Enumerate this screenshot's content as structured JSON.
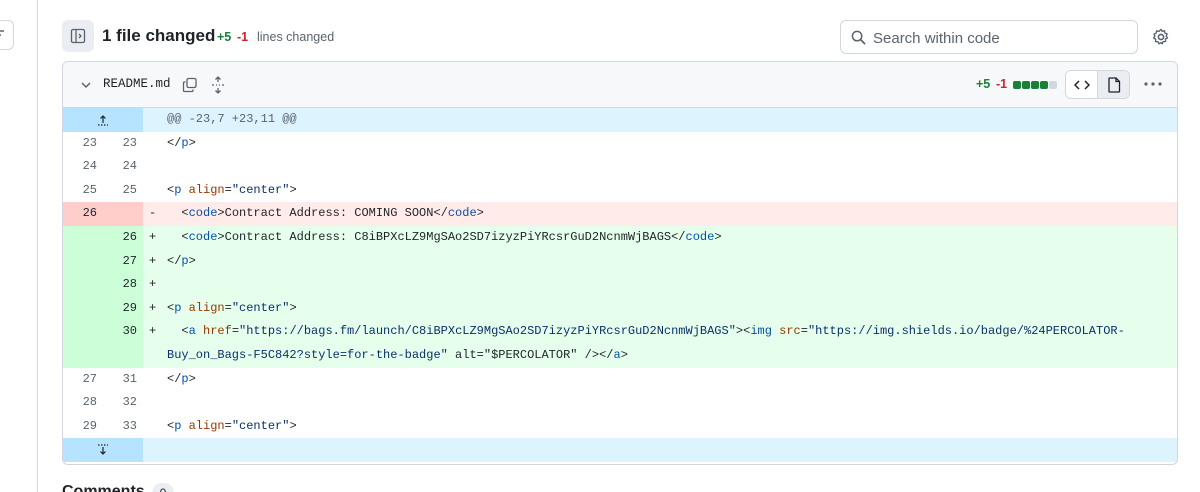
{
  "header": {
    "title": "1 file changed",
    "additions": "+5",
    "deletions": "-1",
    "lines_label": "lines changed",
    "search_placeholder": "Search within code"
  },
  "file": {
    "name": "README.md",
    "additions": "+5",
    "deletions": "-1",
    "diffstat_blocks": [
      "green",
      "green",
      "green",
      "green",
      "gray"
    ]
  },
  "colors": {
    "addition": "#1a7f37",
    "deletion": "#cf222e",
    "add_bg": "#e6ffec",
    "del_bg": "#ffebe9",
    "hunk_bg": "#ddf4ff"
  },
  "diff": {
    "hunk_header": "@@ -23,7 +23,11 @@",
    "lines": [
      {
        "type": "ctx",
        "old": "23",
        "new": "23",
        "sign": "",
        "text": "</p>"
      },
      {
        "type": "ctx",
        "old": "24",
        "new": "24",
        "sign": "",
        "text": ""
      },
      {
        "type": "ctx",
        "old": "25",
        "new": "25",
        "sign": "",
        "text": "<p align=\"center\">"
      },
      {
        "type": "del",
        "old": "26",
        "new": "",
        "sign": "-",
        "text": "  <code>Contract Address: COMING SOON</code>"
      },
      {
        "type": "add",
        "old": "",
        "new": "26",
        "sign": "+",
        "text": "  <code>Contract Address: C8iBPXcLZ9MgSAo2SD7izyzPiYRcsrGuD2NcnmWjBAGS</code>"
      },
      {
        "type": "add",
        "old": "",
        "new": "27",
        "sign": "+",
        "text": "</p>"
      },
      {
        "type": "add",
        "old": "",
        "new": "28",
        "sign": "+",
        "text": ""
      },
      {
        "type": "add",
        "old": "",
        "new": "29",
        "sign": "+",
        "text": "<p align=\"center\">"
      },
      {
        "type": "add",
        "old": "",
        "new": "30",
        "sign": "+",
        "text": "  <a href=\"https://bags.fm/launch/C8iBPXcLZ9MgSAo2SD7izyzPiYRcsrGuD2NcnmWjBAGS\"><img src=\"https://img.shields.io/badge/%24PERCOLATOR-\nBuy_on_Bags-F5C842?style=for-the-badge\" alt=\"$PERCOLATOR\" /></a>"
      },
      {
        "type": "ctx",
        "old": "27",
        "new": "31",
        "sign": "",
        "text": "</p>"
      },
      {
        "type": "ctx",
        "old": "28",
        "new": "32",
        "sign": "",
        "text": ""
      },
      {
        "type": "ctx",
        "old": "29",
        "new": "33",
        "sign": "",
        "text": "<p align=\"center\">"
      }
    ]
  },
  "comments": {
    "label": "Comments",
    "count": "0"
  }
}
